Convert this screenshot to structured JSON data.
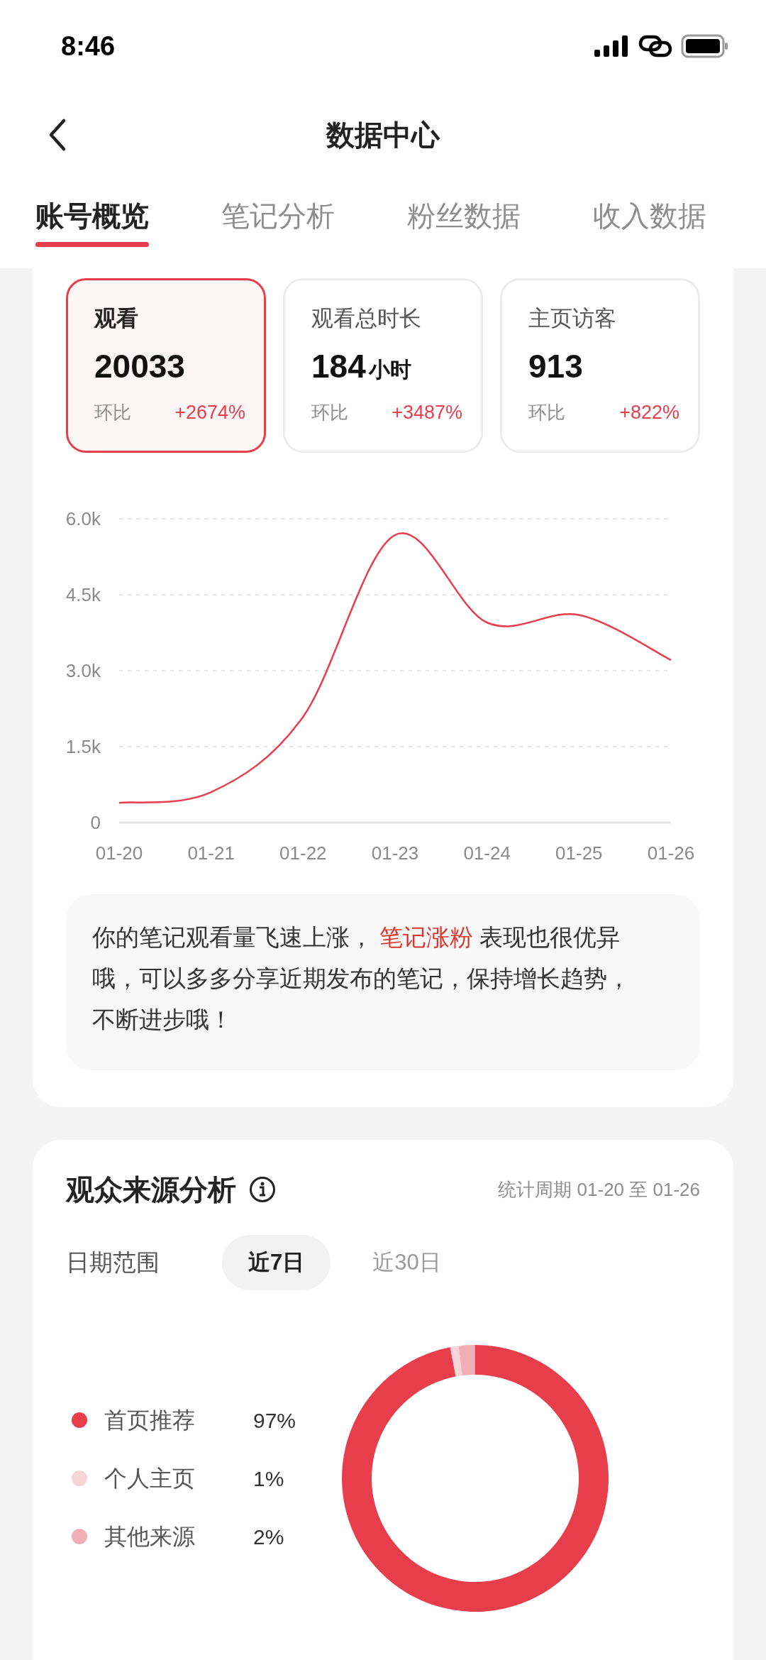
{
  "status_bar": {
    "time": "8:46"
  },
  "header": {
    "title": "数据中心"
  },
  "tabs": [
    {
      "label": "账号概览",
      "selected": true
    },
    {
      "label": "笔记分析",
      "selected": false
    },
    {
      "label": "粉丝数据",
      "selected": false
    },
    {
      "label": "收入数据",
      "selected": false
    }
  ],
  "metrics": [
    {
      "label": "观看",
      "value": "20033",
      "compare_label": "环比",
      "change": "+2674%",
      "selected": true
    },
    {
      "label": "观看总时长",
      "value": "184",
      "unit": "小时",
      "compare_label": "环比",
      "change": "+3487%",
      "selected": false
    },
    {
      "label": "主页访客",
      "value": "913",
      "compare_label": "环比",
      "change": "+822%",
      "selected": false
    }
  ],
  "trend_chart": {
    "chart_data": {
      "type": "line",
      "categories": [
        "01-20",
        "01-21",
        "01-22",
        "01-23",
        "01-24",
        "01-25",
        "01-26"
      ],
      "series": [
        {
          "color": "#e83e4c",
          "values": [
            390,
            600,
            2090,
            5680,
            3950,
            4100,
            3210
          ]
        }
      ],
      "grid": true,
      "ylim": [
        0,
        6000
      ],
      "yticks": [
        {
          "value": 0,
          "label": "0"
        },
        {
          "value": 1500,
          "label": "1.5k"
        },
        {
          "value": 3000,
          "label": "3.0k"
        },
        {
          "value": 4500,
          "label": "4.5k"
        },
        {
          "value": 6000,
          "label": "6.0k"
        }
      ]
    }
  },
  "insight": {
    "parts": [
      {
        "text": "你的笔记观看量飞速上涨， ",
        "highlight": false
      },
      {
        "text": "笔记涨粉",
        "highlight": true
      },
      {
        "text": " 表现也很优异哦，可以多多分享近期发布的笔记，保持增长趋势，不断进步哦！",
        "highlight": false
      }
    ]
  },
  "audience_source": {
    "title": "观众来源分析",
    "period": "统计周期 01-20 至 01-26",
    "range_label": "日期范围",
    "ranges": [
      {
        "label": "近7日",
        "selected": true
      },
      {
        "label": "近30日",
        "selected": false
      }
    ],
    "sources": [
      {
        "name": "首页推荐",
        "percent": "97%",
        "color": "#e83e4c"
      },
      {
        "name": "个人主页",
        "percent": "1%",
        "color": "#f7d4d8"
      },
      {
        "name": "其他来源",
        "percent": "2%",
        "color": "#f2aeb6"
      }
    ],
    "chart_data": {
      "type": "donut",
      "values": [
        97,
        1,
        2
      ]
    }
  }
}
